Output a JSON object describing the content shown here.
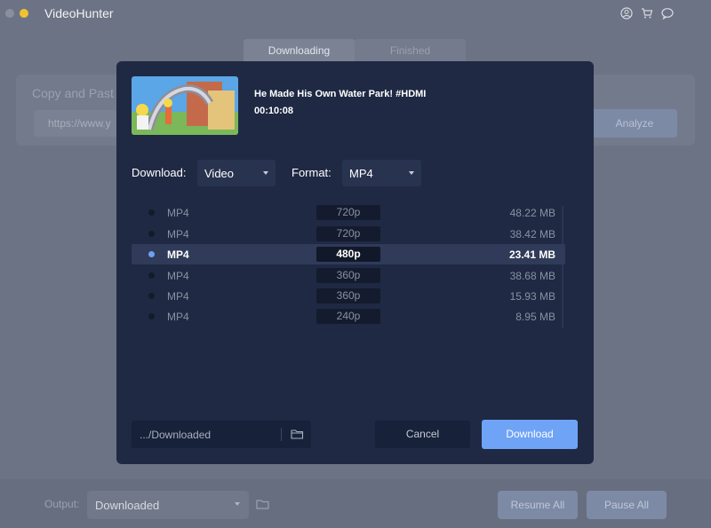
{
  "app": {
    "title": "VideoHunter",
    "icons": [
      "account-icon",
      "cart-icon",
      "chat-icon"
    ]
  },
  "tabs": [
    {
      "label": "Downloading",
      "active": true
    },
    {
      "label": "Finished",
      "active": false
    }
  ],
  "background": {
    "copy_label": "Copy and Past",
    "url_partial": "https://www.y",
    "analyze_label": "Analyze"
  },
  "bottom": {
    "output_label": "Output:",
    "output_value": "Downloaded",
    "resume_label": "Resume All",
    "pause_label": "Pause All"
  },
  "modal": {
    "video_title": "He Made His Own Water Park! #HDMI",
    "duration": "00:10:08",
    "download_label": "Download:",
    "download_type": "Video",
    "format_label": "Format:",
    "format_value": "MP4",
    "options": [
      {
        "format": "MP4",
        "resolution": "720p",
        "size": "48.22 MB",
        "selected": false
      },
      {
        "format": "MP4",
        "resolution": "720p",
        "size": "38.42 MB",
        "selected": false
      },
      {
        "format": "MP4",
        "resolution": "480p",
        "size": "23.41 MB",
        "selected": true
      },
      {
        "format": "MP4",
        "resolution": "360p",
        "size": "38.68 MB",
        "selected": false
      },
      {
        "format": "MP4",
        "resolution": "360p",
        "size": "15.93 MB",
        "selected": false
      },
      {
        "format": "MP4",
        "resolution": "240p",
        "size": "8.95 MB",
        "selected": false
      }
    ],
    "path": ".../Downloaded",
    "cancel_label": "Cancel",
    "download_button_label": "Download"
  },
  "colors": {
    "accent": "#6fa3f5",
    "modal_bg": "#1f2943",
    "overlay_bg": "#6c7384"
  }
}
